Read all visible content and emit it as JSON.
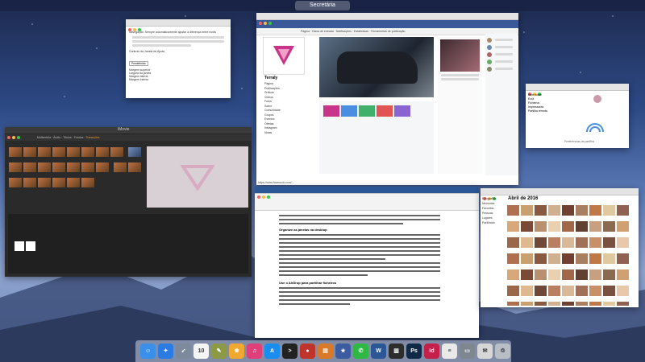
{
  "spaces": {
    "label": "Secretária"
  },
  "prefs_window": {
    "checkbox_1": "Navegação: Sempre automaticamente ajustar a diferença entre ecrãs",
    "section_label": "Controlo da Janela de Ajuda",
    "button": "Predefinido",
    "fields": [
      "Margem superior",
      "Largura da janela",
      "Margem lateral",
      "Margem inferior"
    ]
  },
  "facebook_window": {
    "page_name": "Terraly",
    "tabs": [
      "Página",
      "Caixa de entrada",
      "Notificações",
      "Estatísticas",
      "Ferramentas de publicação"
    ],
    "sidebar": [
      "Página",
      "Publicações",
      "Críticas",
      "Vídeos",
      "Fotos",
      "Sobre",
      "Comunidade",
      "Grupos",
      "Eventos",
      "Ofertas",
      "Instagram",
      "Notas"
    ],
    "bottom_url": "https://www.facebook.com/..."
  },
  "imovie_window": {
    "title": "iMovie",
    "tabs": [
      "Multimédia",
      "Áudio",
      "Títulos",
      "Fundos",
      "Transições"
    ]
  },
  "word_window": {
    "heading_1": "Organize as janelas na desktop",
    "heading_2": "Use o AirDrop para partilhar ficheiros"
  },
  "photos_window": {
    "title": "Abril de 2016",
    "sidebar": [
      "Fotografias",
      "Memórias",
      "Favoritos",
      "Pessoas",
      "Lugares",
      "Partilhado"
    ]
  },
  "sharing_window": {
    "caption": "Preferências de partilha",
    "items": [
      "Sem nome",
      "Ecrã",
      "Ficheiros",
      "Impressoras",
      "Partilha remota"
    ]
  },
  "dock": {
    "items": [
      {
        "name": "finder",
        "color": "#3a8fe8",
        "glyph": "☺"
      },
      {
        "name": "safari",
        "color": "#2a7be4",
        "glyph": "✦"
      },
      {
        "name": "rocket",
        "color": "#7d8a9c",
        "glyph": "➶"
      },
      {
        "name": "calendar",
        "color": "#f4f4f4",
        "glyph": "10"
      },
      {
        "name": "notes",
        "color": "#8c9a46",
        "glyph": "✎"
      },
      {
        "name": "photos",
        "color": "#f0a830",
        "glyph": "❀"
      },
      {
        "name": "itunes",
        "color": "#e0407a",
        "glyph": "♫"
      },
      {
        "name": "app-store",
        "color": "#1a8df0",
        "glyph": "A"
      },
      {
        "name": "terminal",
        "color": "#222222",
        "glyph": ">"
      },
      {
        "name": "recorder",
        "color": "#c0342c",
        "glyph": "●"
      },
      {
        "name": "ibooks",
        "color": "#d87a2a",
        "glyph": "▤"
      },
      {
        "name": "star",
        "color": "#3d5ba0",
        "glyph": "★"
      },
      {
        "name": "whatsapp",
        "color": "#2fb944",
        "glyph": "✆"
      },
      {
        "name": "word",
        "color": "#2b5797",
        "glyph": "W"
      },
      {
        "name": "numbers",
        "color": "#2d2d2d",
        "glyph": "▥"
      },
      {
        "name": "photoshop",
        "color": "#0e2a46",
        "glyph": "Ps"
      },
      {
        "name": "indesign",
        "color": "#c4204a",
        "glyph": "Id"
      },
      {
        "name": "doc",
        "color": "#e9e9e9",
        "glyph": "≡"
      },
      {
        "name": "preview",
        "color": "#7e8790",
        "glyph": "▭"
      },
      {
        "name": "mail",
        "color": "#d7d7d7",
        "glyph": "✉"
      },
      {
        "name": "trash",
        "color": "#b8bec6",
        "glyph": "♲"
      }
    ]
  }
}
